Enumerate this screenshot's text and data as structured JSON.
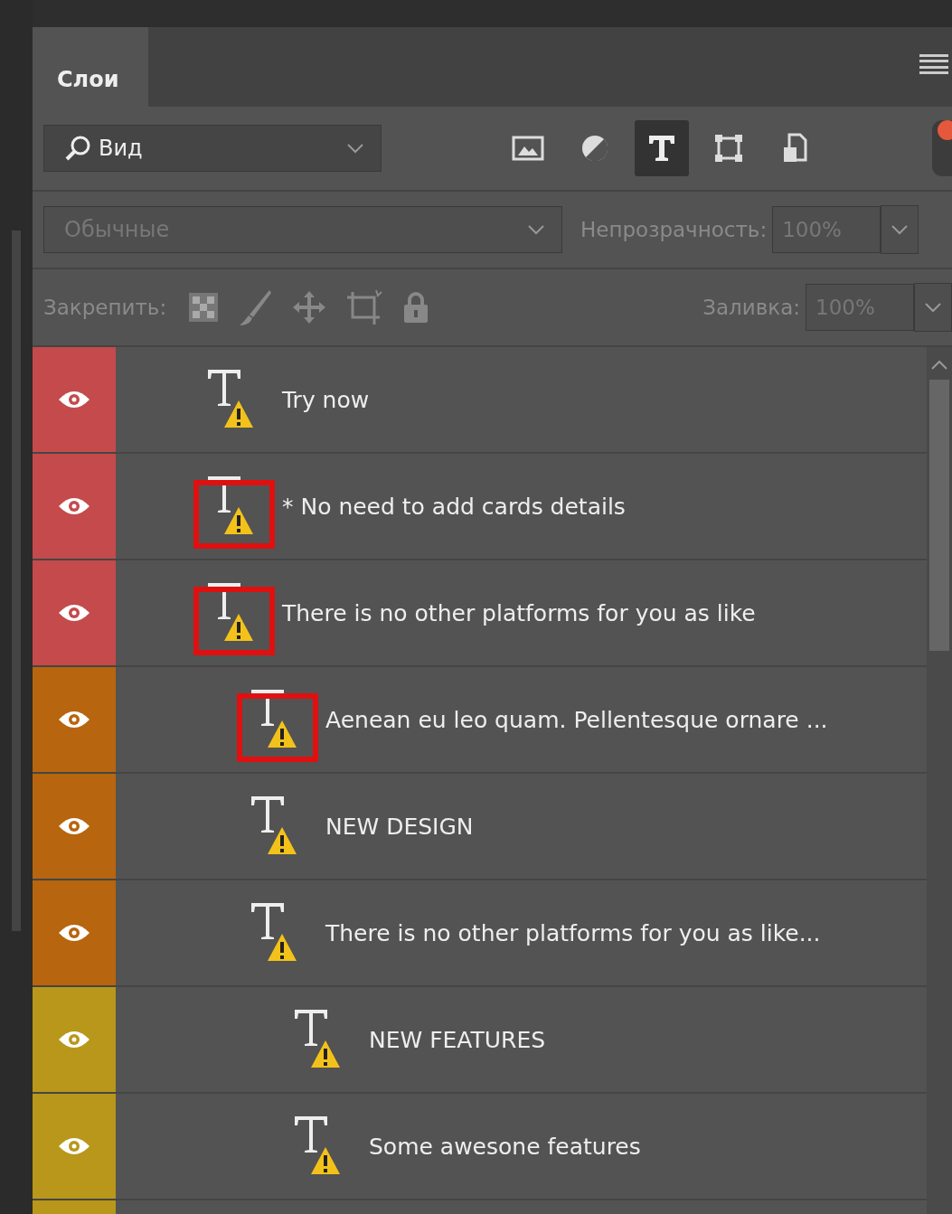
{
  "panel": {
    "tab": "Слои",
    "selected": true
  },
  "filter": {
    "value": "Вид",
    "icons": [
      {
        "kind": "image",
        "selected": false
      },
      {
        "kind": "adjustment",
        "selected": false
      },
      {
        "kind": "type",
        "selected": true
      },
      {
        "kind": "shape",
        "selected": false
      },
      {
        "kind": "smart",
        "selected": false
      }
    ],
    "toggle_on": true
  },
  "blend": {
    "value": "Обычные",
    "disabled": true,
    "opacity_label": "Непрозрачность:",
    "opacity": "100%"
  },
  "lock": {
    "label": "Закрепить:",
    "icons": [
      {
        "kind": "pixels"
      },
      {
        "kind": "paint"
      },
      {
        "kind": "move"
      },
      {
        "kind": "artboard"
      },
      {
        "kind": "all"
      }
    ],
    "fill_label": "Заливка:",
    "fill": "100%",
    "disabled": true
  },
  "layers": [
    {
      "name": "Try now",
      "color": "#c44a4c",
      "visible": true,
      "warning": true,
      "highlighted": false
    },
    {
      "name": "* No need to add cards details",
      "color": "#c44a4c",
      "visible": true,
      "warning": true,
      "highlighted": true
    },
    {
      "name": "There is no other platforms for you as like",
      "color": "#c44a4c",
      "visible": true,
      "warning": true,
      "highlighted": true,
      "children": [
        {
          "name": "Aenean eu leo quam. Pellentesque ornare ...",
          "color": "#b7650e",
          "visible": true,
          "warning": true,
          "highlighted": true
        },
        {
          "name": "NEW DESIGN",
          "color": "#b7650e",
          "visible": true,
          "warning": true,
          "highlighted": false
        },
        {
          "name": "There is no other platforms for you as like...",
          "color": "#b7650e",
          "visible": true,
          "warning": true,
          "highlighted": false,
          "children": [
            {
              "name": "NEW FEATURES",
              "color": "#b8971a",
              "visible": true,
              "warning": true,
              "highlighted": false
            },
            {
              "name": "Some awesone features",
              "color": "#b8971a",
              "visible": true,
              "warning": true,
              "highlighted": false
            },
            {
              "color": "#b8971a"
            }
          ]
        }
      ]
    }
  ]
}
